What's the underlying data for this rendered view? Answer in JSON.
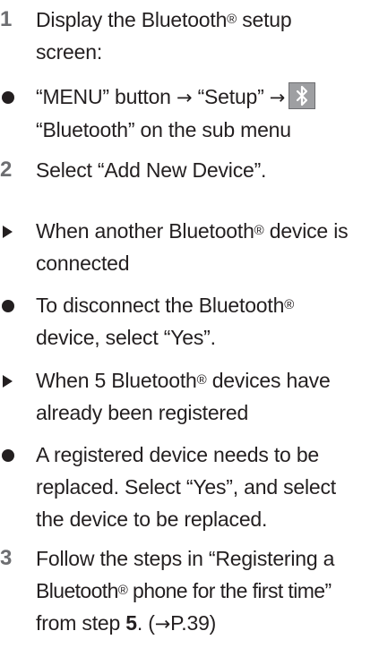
{
  "step1": {
    "number": "1",
    "line1_pre": "Display the Bluetooth",
    "line1_reg": "®",
    "line1_post": " setup",
    "line2": "screen:"
  },
  "bullet1": {
    "line1_a": "“MENU” button ",
    "arrow1": "→",
    "line1_b": " “Setup” ",
    "arrow2": "→",
    "icon": "bluetooth-icon",
    "line2": "“Bluetooth” on the sub menu"
  },
  "step2": {
    "number": "2",
    "text": "Select “Add New Device”."
  },
  "case1": {
    "line1_pre": "When another Bluetooth",
    "line1_reg": "®",
    "line1_post": " device is",
    "line2": "connected"
  },
  "bullet2": {
    "line1_pre": "To disconnect the Bluetooth",
    "line1_reg": "®",
    "line2": "device, select “Yes”."
  },
  "case2": {
    "line1_pre": "When 5 Bluetooth",
    "line1_reg": "®",
    "line1_post": " devices have",
    "line2": "already been registered"
  },
  "bullet3": {
    "line1": "A registered device needs to be",
    "line2": "replaced. Select “Yes”, and select",
    "line3": "the device to be replaced."
  },
  "step3": {
    "number": "3",
    "line1": "Follow the steps in “Registering a",
    "line2_pre": "Bluetooth",
    "line2_reg": "®",
    "line2_post": " phone for the first time”",
    "line3_pre": "from step ",
    "line3_step": "5",
    "line3_mid": ". (",
    "line3_arrow": "→",
    "line3_post": "P.39)"
  }
}
